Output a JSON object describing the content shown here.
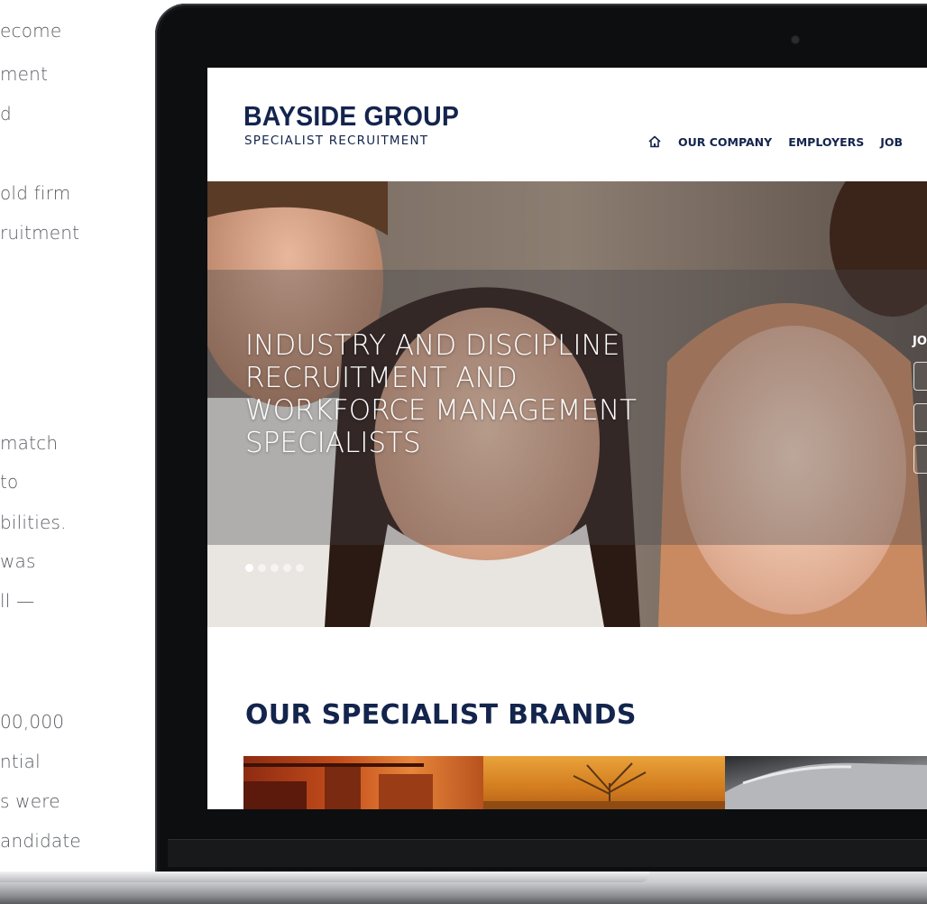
{
  "left_text": [
    "ecome",
    "ment",
    "d",
    "old firm",
    "ruitment",
    "match",
    "to",
    "bilities.",
    "was",
    "ll —",
    "00,000",
    "ntial",
    "s were",
    "andidate"
  ],
  "site": {
    "brand": {
      "name": "BAYSIDE GROUP",
      "tagline": "SPECIALIST RECRUITMENT"
    },
    "nav": {
      "home_icon": "home-icon",
      "items": [
        "OUR COMPANY",
        "EMPLOYERS",
        "JOB"
      ]
    },
    "hero": {
      "title_lines": [
        "INDUSTRY AND DISCIPLINE",
        "RECRUITMENT AND",
        "WORKFORCE MANAGEMENT",
        "SPECIALISTS"
      ],
      "side_label": "JO",
      "slide_count": 5,
      "active_slide": 1
    },
    "brands": {
      "heading": "OUR SPECIALIST BRANDS"
    }
  },
  "colors": {
    "navy": "#13244d",
    "body_text": "#5a5d63",
    "laptop_bezel": "#0d0e10"
  }
}
